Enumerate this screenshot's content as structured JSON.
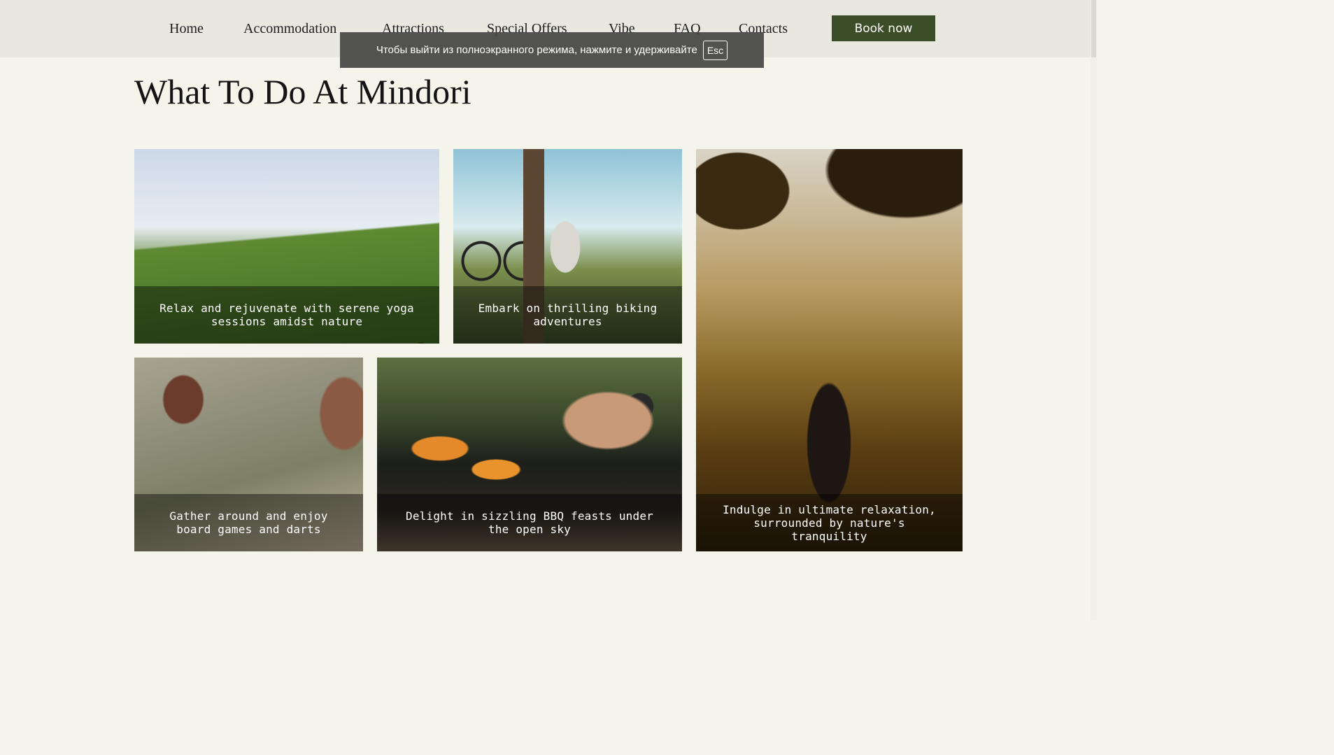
{
  "nav": {
    "items": [
      {
        "label": "Home"
      },
      {
        "label": "Accommodation"
      },
      {
        "label": "Attractions"
      },
      {
        "label": "Special Offers"
      },
      {
        "label": "Vibe"
      },
      {
        "label": "FAQ"
      },
      {
        "label": "Contacts"
      }
    ],
    "book_label": "Book now"
  },
  "fullscreen_notice": {
    "text": "Чтобы выйти из полноэкранного режима, нажмите и удерживайте",
    "key": "Esc"
  },
  "section": {
    "title": "What To Do At Mindori",
    "cards": [
      {
        "caption": "Relax and rejuvenate with serene yoga sessions amidst nature"
      },
      {
        "caption": "Embark on thrilling biking adventures"
      },
      {
        "caption": "Indulge in ultimate relaxation, surrounded by nature's tranquility"
      },
      {
        "caption": "Gather around and enjoy board games and darts"
      },
      {
        "caption": "Delight in sizzling BBQ feasts under the open sky"
      }
    ]
  },
  "colors": {
    "page_bg": "#f5f4eb",
    "header_bg": "#e8e7e0",
    "accent": "#3b4e27"
  }
}
